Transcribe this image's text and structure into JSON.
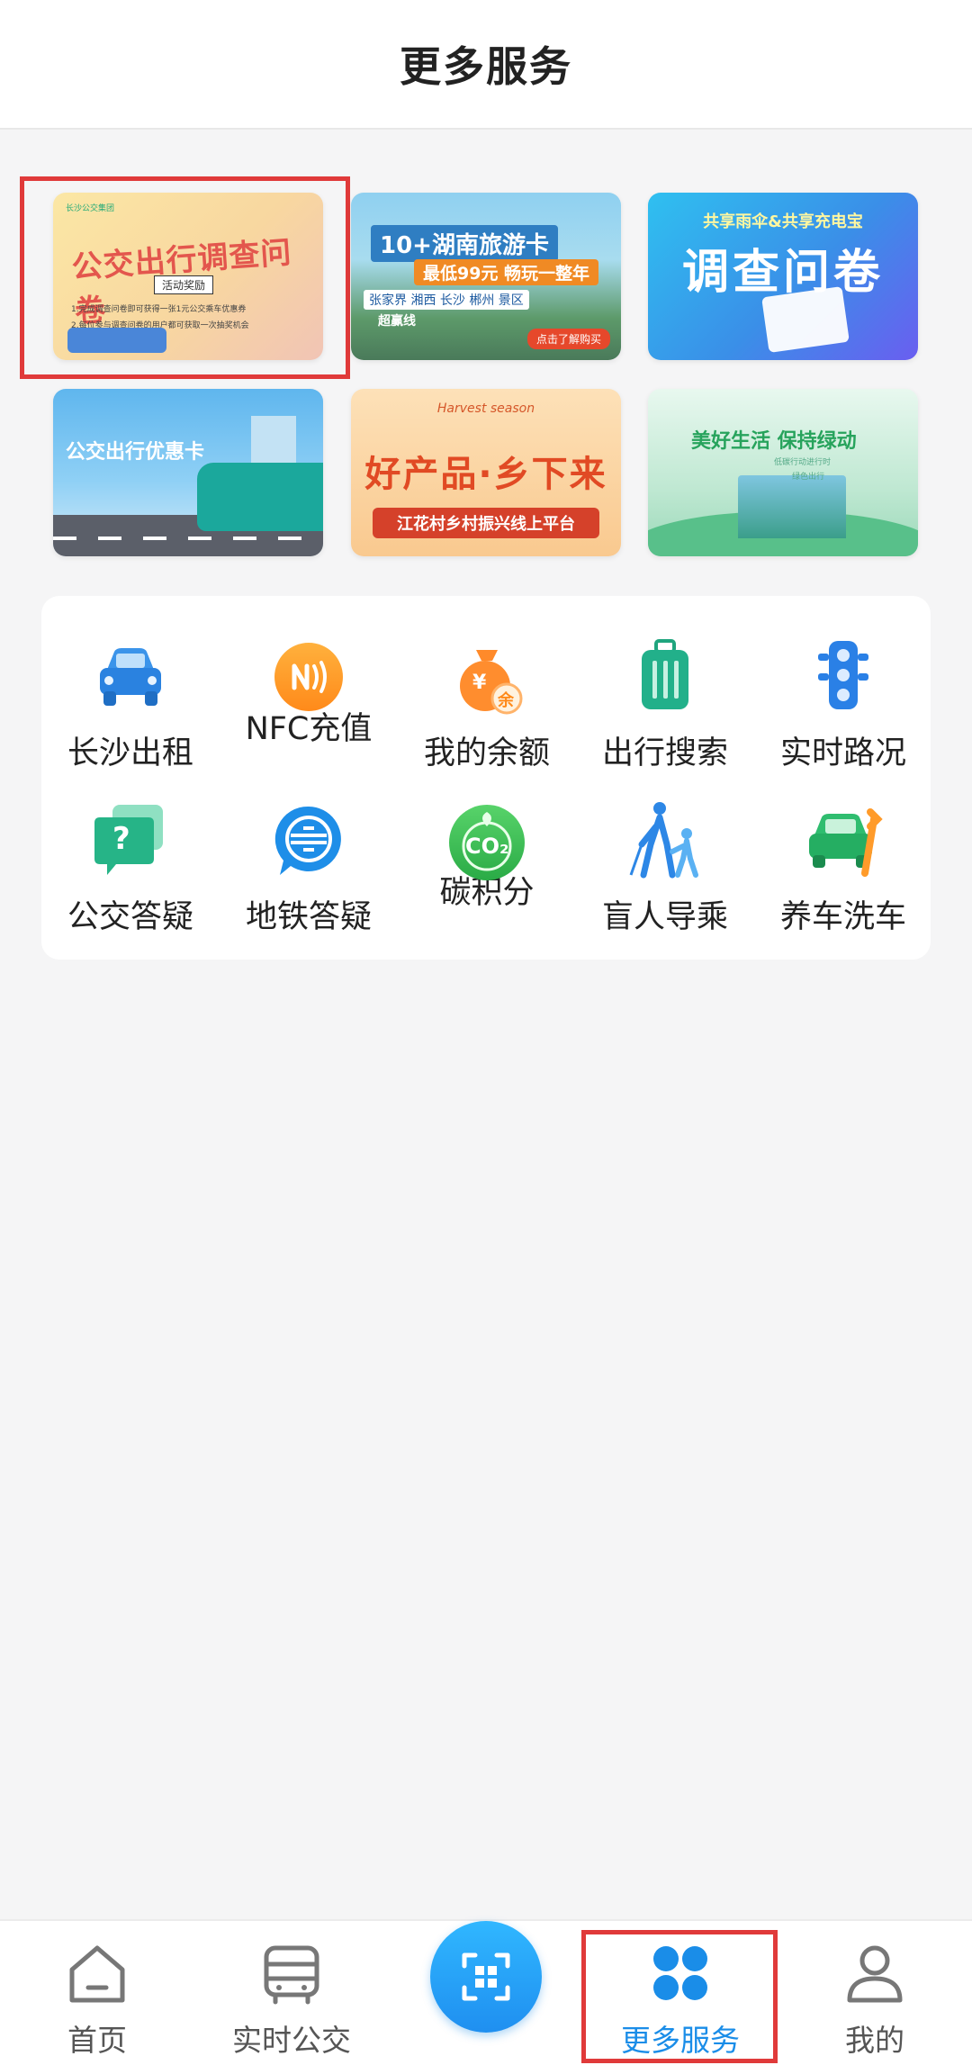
{
  "header": {
    "title": "更多服务"
  },
  "banners": [
    {
      "logo": "长沙公交集团",
      "title": "公交出行调查问卷",
      "tag": "活动奖励",
      "desc1": "1.完成调查问卷即可获得一张1元公交乘车优惠券",
      "desc2": "2.每位参与调查问卷的用户都可获取一次抽奖机会"
    },
    {
      "title": "10+湖南旅游卡",
      "subtitle": "最低99元 畅玩一整年",
      "places": "张家界 湘西 长沙 郴州 景区",
      "tag": "超赢线",
      "button": "点击了解购买"
    },
    {
      "subtitle": "共享雨伞&共享充电宝",
      "title": "调查问卷"
    },
    {
      "title": "公交出行优惠卡"
    },
    {
      "arc": "Harvest season",
      "title": "好产品·乡下来",
      "subtitle": "江花村乡村振兴线上平台"
    },
    {
      "title": "美好生活 保持绿动",
      "line1": "低碳行动进行时",
      "line2": "绿色出行"
    }
  ],
  "services": [
    {
      "label": "长沙出租",
      "icon": "taxi-icon"
    },
    {
      "label": "NFC充值",
      "icon": "nfc-icon"
    },
    {
      "label": "我的余额",
      "icon": "balance-bag-icon",
      "badge": "余",
      "symbol": "¥"
    },
    {
      "label": "出行搜索",
      "icon": "luggage-icon"
    },
    {
      "label": "实时路况",
      "icon": "traffic-light-icon"
    },
    {
      "label": "公交答疑",
      "icon": "question-chat-icon",
      "symbol": "?"
    },
    {
      "label": "地铁答疑",
      "icon": "metro-chat-icon"
    },
    {
      "label": "碳积分",
      "icon": "co2-icon",
      "symbol": "CO₂"
    },
    {
      "label": "盲人导乘",
      "icon": "blind-guide-icon"
    },
    {
      "label": "养车洗车",
      "icon": "car-wrench-icon"
    }
  ],
  "nav": {
    "items": [
      {
        "label": "首页",
        "icon": "home-icon"
      },
      {
        "label": "实时公交",
        "icon": "bus-icon"
      },
      {
        "label": "",
        "icon": "scan-icon"
      },
      {
        "label": "更多服务",
        "icon": "clover-icon"
      },
      {
        "label": "我的",
        "icon": "user-icon"
      }
    ],
    "active": "更多服务"
  },
  "colors": {
    "accent": "#1a8de8",
    "highlight": "#e03a3a"
  }
}
